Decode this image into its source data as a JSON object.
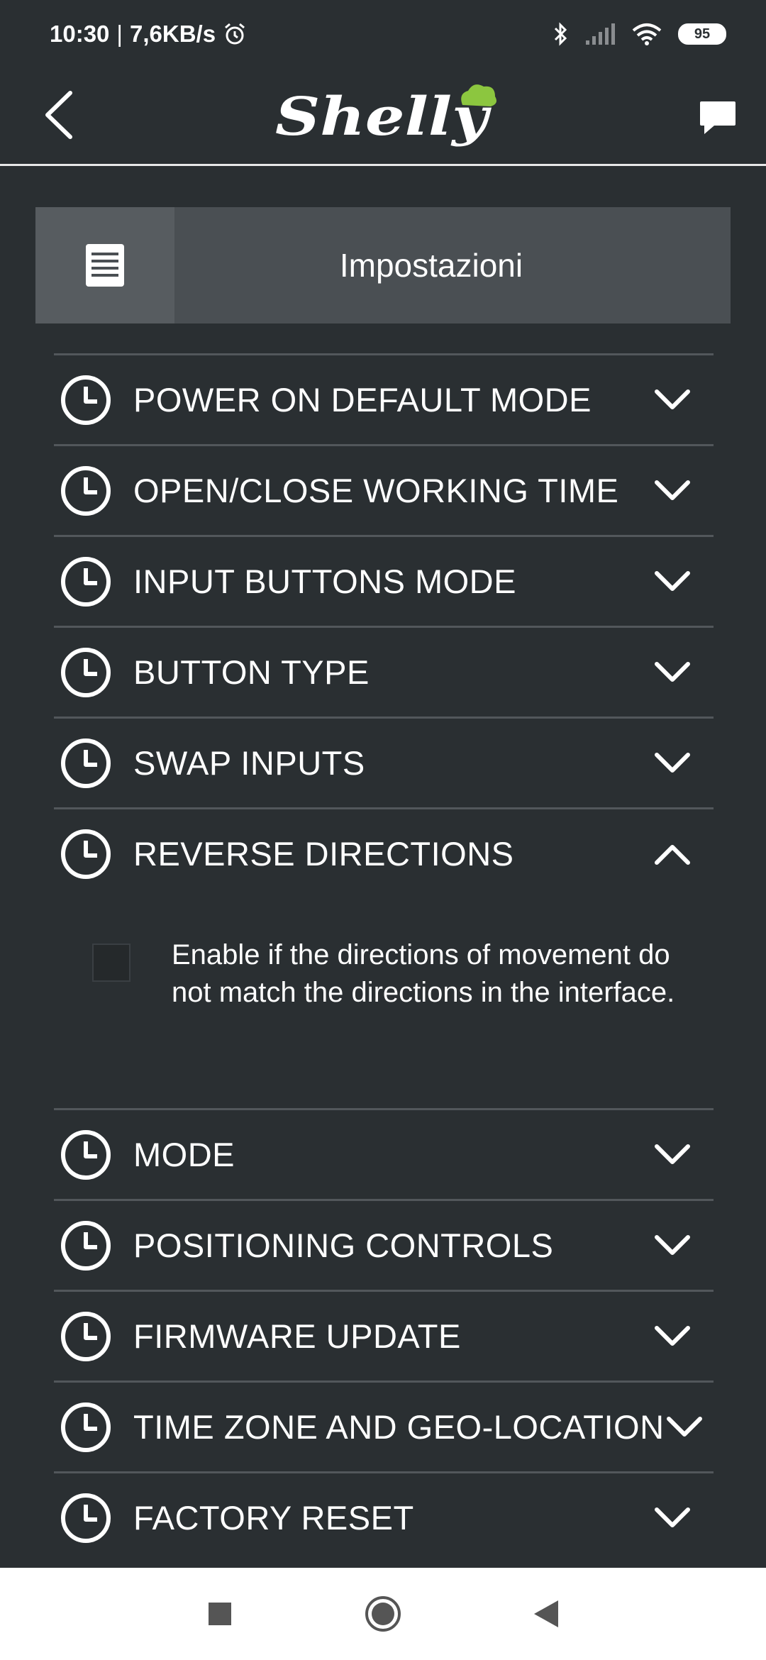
{
  "status_bar": {
    "time": "10:30",
    "separator": "|",
    "speed": "7,6KB/s",
    "battery": "95",
    "icons": [
      "alarm-icon",
      "bluetooth-icon",
      "signal-icon",
      "wifi-icon",
      "battery-icon"
    ]
  },
  "header": {
    "brand": "Shelly",
    "accent_color": "#8cc63f"
  },
  "section": {
    "title": "Impostazioni",
    "icon": "document-icon"
  },
  "settings": {
    "items": [
      {
        "label": "POWER ON DEFAULT MODE",
        "expanded": false
      },
      {
        "label": "OPEN/CLOSE WORKING TIME",
        "expanded": false
      },
      {
        "label": "INPUT BUTTONS MODE",
        "expanded": false
      },
      {
        "label": "BUTTON TYPE",
        "expanded": false
      },
      {
        "label": "SWAP INPUTS",
        "expanded": false
      },
      {
        "label": "REVERSE DIRECTIONS",
        "expanded": true
      },
      {
        "label": "MODE",
        "expanded": false
      },
      {
        "label": "POSITIONING CONTROLS",
        "expanded": false
      },
      {
        "label": "FIRMWARE UPDATE",
        "expanded": false
      },
      {
        "label": "TIME ZONE AND GEO-LOCATION",
        "expanded": false
      },
      {
        "label": "FACTORY RESET",
        "expanded": false
      }
    ],
    "reverse_directions": {
      "checked": false,
      "description": "Enable if the directions of movement do not match the directions in the interface."
    }
  },
  "nav": {
    "icons": [
      "recents-square-icon",
      "home-circle-icon",
      "back-triangle-icon"
    ]
  }
}
